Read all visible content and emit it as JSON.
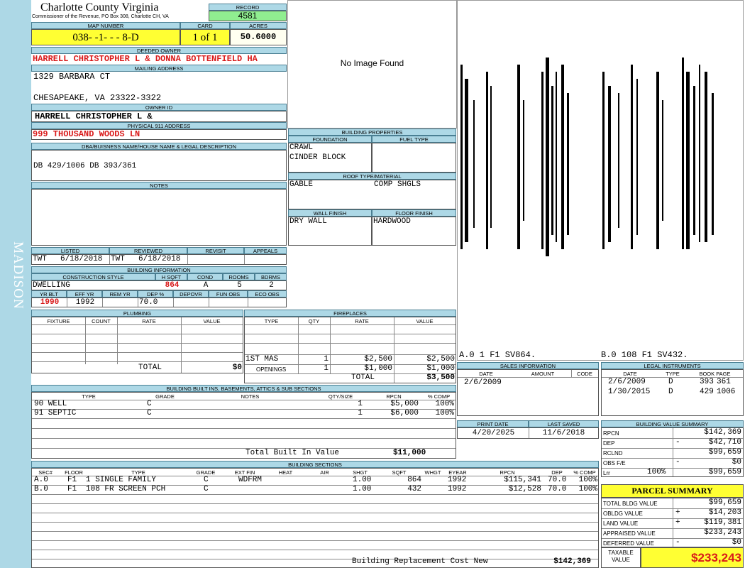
{
  "sidebar": {
    "district": "MADISON"
  },
  "header": {
    "county": "Charlotte County Virginia",
    "commissioner": "Commissioner of the Revenue, PO Box 308, Charlotte CH, VA",
    "record_label": "RECORD",
    "record": "4581",
    "map_label": "MAP NUMBER",
    "map_number": "038- -1- - - 8-D",
    "card_label": "CARD",
    "card": "1 of 1",
    "acres_label": "ACRES",
    "acres": "50.6000"
  },
  "owner": {
    "deeded_label": "DEEDED OWNER",
    "deeded_owner": "HARRELL CHRISTOPHER L & DONNA BOTTENFIELD HA",
    "mailing_label": "MAILING ADDRESS",
    "mailing_line1": "1329 BARBARA CT",
    "mailing_line2": "CHESAPEAKE, VA 23322-3322",
    "owner_id_label": "OWNER ID",
    "owner_id": "HARRELL CHRISTOPHER L &",
    "physical_label": "PHYSICAL 911 ADDRESS",
    "physical_address": "999 THOUSAND WOODS LN"
  },
  "legal": {
    "label": "DBA/BUISNESS NAME/HOUSE NAME & LEGAL DESCRIPTION",
    "text": "DB 429/1006 DB 393/361"
  },
  "notes": {
    "label": "NOTES",
    "text": ""
  },
  "image": {
    "no_image": "No Image Found"
  },
  "building_props": {
    "title": "BUILDING PROPERTIES",
    "foundation_label": "FOUNDATION",
    "foundation1": "CRAWL",
    "foundation2": "CINDER BLOCK",
    "fuel_label": "FUEL TYPE",
    "fuel": "",
    "roof_label": "ROOF TYPE/MATERIAL",
    "roof_type": "GABLE",
    "roof_material": "COMP SHGLS",
    "wall_label": "WALL FINISH",
    "wall": "DRY WALL",
    "floor_label": "FLOOR FINISH",
    "floor": "HARDWOOD"
  },
  "sketch": {
    "caption_a": "A.0 1 F1 SV864.",
    "caption_b": "B.0 108 F1 SV432."
  },
  "review": {
    "listed_label": "LISTED",
    "listed_by": "TWT",
    "listed_date": "6/18/2018",
    "reviewed_label": "REVIEWED",
    "reviewed_by": "TWT",
    "reviewed_date": "6/18/2018",
    "revisit_label": "REVISIT",
    "appeals_label": "APPEALS"
  },
  "building_info": {
    "title": "BUILDING INFORMATION",
    "style_label": "CONSTRUCTION STYLE",
    "style": "DWELLING",
    "hsqft_label": "H SQFT",
    "hsqft": "864",
    "cond_label": "COND",
    "cond": "A",
    "rooms_label": "ROOMS",
    "rooms": "5",
    "bdrms_label": "BDRMS",
    "bdrms": "2",
    "yrblt_label": "YR BLT",
    "yrblt": "1990",
    "effyr_label": "EFF YR",
    "effyr": "1992",
    "remyr_label": "REM YR",
    "remyr": "",
    "dep_label": "DEP %",
    "dep": "70.0",
    "depovr_label": "DEPOVR",
    "funobs_label": "FUN OBS",
    "ecoobs_label": "ECO OBS"
  },
  "plumbing": {
    "title": "PLUMBING",
    "cols": [
      "FIXTURE",
      "COUNT",
      "RATE",
      "VALUE"
    ],
    "total_label": "TOTAL",
    "total": "$0"
  },
  "fireplaces": {
    "title": "FIREPLACES",
    "cols": [
      "TYPE",
      "QTY",
      "RATE",
      "VALUE"
    ],
    "rows": [
      {
        "type": "1ST MAS",
        "qty": "1",
        "rate": "$2,500",
        "value": "$2,500"
      },
      {
        "type": "OPENINGS",
        "qty": "1",
        "rate": "$1,000",
        "value": "$1,000"
      }
    ],
    "total_label": "TOTAL",
    "total": "$3,500"
  },
  "builtins": {
    "title": "BUILDING BUILT INS, BASEMENTS, ATTICS & SUB SECTIONS",
    "cols": [
      "TYPE",
      "GRADE",
      "NOTES",
      "QTY/SIZE",
      "RPCN",
      "% COMP"
    ],
    "rows": [
      {
        "type": "90 WELL",
        "grade": "C",
        "notes": "",
        "qty": "1",
        "rpcn": "$5,000",
        "comp": "100%"
      },
      {
        "type": "91 SEPTIC",
        "grade": "C",
        "notes": "",
        "qty": "1",
        "rpcn": "$6,000",
        "comp": "100%"
      }
    ],
    "total_label": "Total Built In Value",
    "total": "$11,000"
  },
  "sales": {
    "title": "SALES INFORMATION",
    "cols": [
      "DATE",
      "AMOUNT",
      "CODE"
    ],
    "rows": [
      {
        "date": "2/6/2009",
        "amount": "",
        "code": ""
      }
    ]
  },
  "legal_instruments": {
    "title": "LEGAL INSTRUMENTS",
    "cols": [
      "DATE",
      "TYPE",
      "BOOK PAGE"
    ],
    "rows": [
      {
        "date": "2/6/2009",
        "type": "D",
        "book": "393",
        "page": "361"
      },
      {
        "date": "1/30/2015",
        "type": "D",
        "book": "429",
        "page": "1006"
      }
    ]
  },
  "print_info": {
    "print_label": "PRINT DATE",
    "print_date": "4/20/2025",
    "saved_label": "LAST SAVED",
    "saved_date": "11/6/2018"
  },
  "value_summary": {
    "title": "BUILDING VALUE SUMMARY",
    "rows": [
      {
        "label": "RPCN",
        "op": "",
        "pct": "",
        "value": "$142,369"
      },
      {
        "label": "DEP",
        "op": "-",
        "pct": "",
        "value": "$42,710"
      },
      {
        "label": "RCLND",
        "op": "",
        "pct": "",
        "value": "$99,659"
      },
      {
        "label": "OBS F/E",
        "op": "-",
        "pct": "",
        "value": "$0"
      },
      {
        "label": "Lrr",
        "op": "",
        "pct": "100%",
        "value": "$99,659"
      }
    ]
  },
  "parcel_summary": {
    "title": "PARCEL SUMMARY",
    "rows": [
      {
        "label": "TOTAL BLDG VALUE",
        "op": "",
        "value": "$99,659"
      },
      {
        "label": "OBLDG VALUE",
        "op": "+",
        "value": "$14,203"
      },
      {
        "label": "LAND VALUE",
        "op": "+",
        "value": "$119,381"
      },
      {
        "label": "APPRAISED VALUE",
        "op": "",
        "value": "$233,243"
      },
      {
        "label": "DEFERRED VALUE",
        "op": "-",
        "value": "$0"
      }
    ],
    "taxable_label1": "TAXABLE",
    "taxable_label2": "VALUE",
    "taxable": "$233,243"
  },
  "sections": {
    "title": "BUILDING SECTIONS",
    "cols": [
      "SEC#",
      "FLOOR",
      "TYPE",
      "GRADE",
      "EXT FIN",
      "HEAT",
      "AIR",
      "SHGT",
      "SQFT",
      "WHGT",
      "EYEAR",
      "RPCN",
      "DEP",
      "% COMP"
    ],
    "rows": [
      {
        "sec": "A.0",
        "floor": "F1",
        "type": "1 SINGLE FAMILY",
        "grade": "C",
        "ext": "WDFRM",
        "heat": "",
        "air": "",
        "shgt": "1.00",
        "sqft": "864",
        "whgt": "",
        "eyear": "1992",
        "rpcn": "$115,341",
        "dep": "70.0",
        "comp": "100%"
      },
      {
        "sec": "B.0",
        "floor": "F1",
        "type": "108 FR SCREEN PCH",
        "grade": "C",
        "ext": "",
        "heat": "",
        "air": "",
        "shgt": "1.00",
        "sqft": "432",
        "whgt": "",
        "eyear": "1992",
        "rpcn": "$12,528",
        "dep": "70.0",
        "comp": "100%"
      }
    ],
    "total_label": "Building Replacement Cost New",
    "total": "$142,369"
  }
}
